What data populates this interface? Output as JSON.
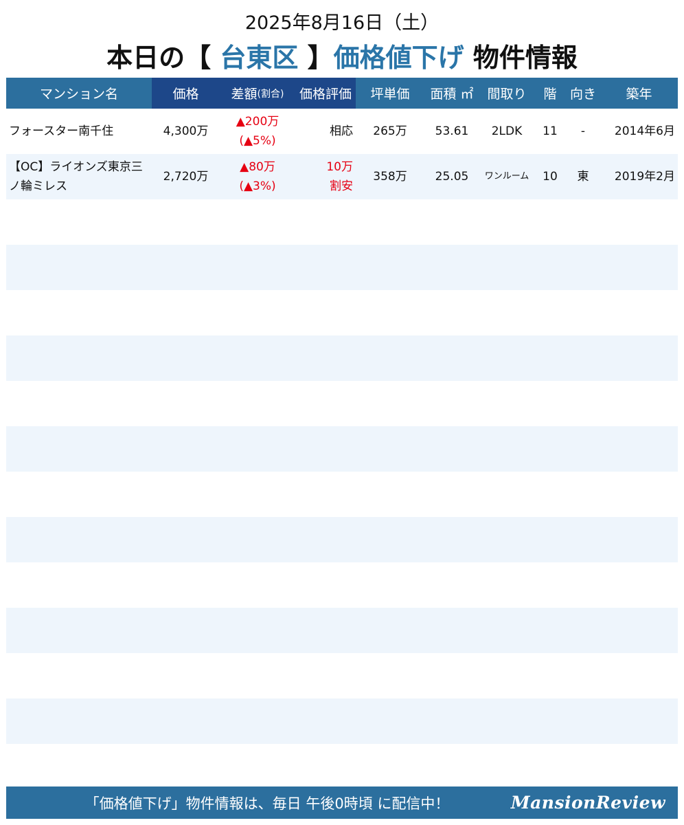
{
  "header": {
    "date": "2025年8月16日（土）",
    "title_prefix": "本日の【",
    "area": "台東区",
    "title_mid": "】",
    "title_blue": "価格値下げ",
    "title_suffix": " 物件情報"
  },
  "columns": {
    "name": "マンション名",
    "price": "価格",
    "diff_main": "差額",
    "diff_sub": "(割合)",
    "evaluation": "価格評価",
    "tsubo_price": "坪単価",
    "area": "面積 ㎡",
    "layout": "間取り",
    "floor": "階",
    "direction": "向き",
    "built": "築年"
  },
  "rows": [
    {
      "name": "フォースター南千住",
      "price": "4,300万",
      "diff": "▲200万",
      "ratio": "(▲5%)",
      "evaluation_line1": "相応",
      "evaluation_line2": "",
      "tsubo_price": "265万",
      "area": "53.61",
      "layout": "2LDK",
      "floor": "11",
      "direction": "-",
      "built": "2014年6月"
    },
    {
      "name": "【OC】ライオンズ東京三ノ輪ミレス",
      "price": "2,720万",
      "diff": "▲80万",
      "ratio": "(▲3%)",
      "evaluation_line1": "10万",
      "evaluation_line2": "割安",
      "tsubo_price": "358万",
      "area": "25.05",
      "layout": "ワンルーム",
      "floor": "10",
      "direction": "東",
      "built": "2019年2月"
    }
  ],
  "footer": {
    "message": "「価格値下げ」物件情報は、毎日 午後0時頃 に配信中！",
    "logo": "MansionReview"
  },
  "colors": {
    "header_blue": "#2c6f9e",
    "header_dark": "#1d4789",
    "accent_blue": "#2a75a8",
    "alert_red": "#e60012",
    "stripe": "#eef5fc"
  }
}
